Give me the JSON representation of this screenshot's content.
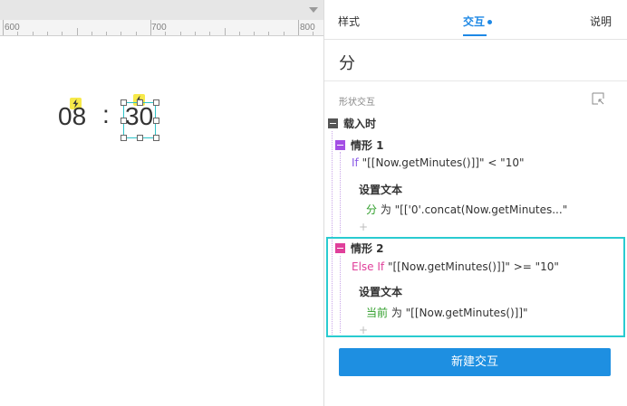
{
  "canvas": {
    "ruler_labels": [
      "600",
      "700",
      "800"
    ],
    "hour": "08",
    "separator": ":",
    "minute": "30"
  },
  "panel": {
    "tabs": [
      {
        "label": "样式",
        "active": false
      },
      {
        "label": "交互",
        "active": true,
        "has_dot": true
      },
      {
        "label": "说明",
        "active": false
      }
    ],
    "shape_name": "分",
    "section_title": "形状交互",
    "event": {
      "label": "载入时"
    },
    "cases": [
      {
        "label": "情形 1",
        "condition_keyword": "If",
        "condition_text": " \"[[Now.getMinutes()]]\" < \"10\"",
        "action_title": "设置文本",
        "target": "分",
        "action_detail": " 为 \"[['0'.concat(Now.getMinutes...\"",
        "add": "+"
      },
      {
        "label": "情形 2",
        "condition_keyword": "Else If",
        "condition_text": " \"[[Now.getMinutes()]]\" >= \"10\"",
        "action_title": "设置文本",
        "target": "当前",
        "action_detail": " 为 \"[[Now.getMinutes()]]\"",
        "add": "+"
      }
    ],
    "new_interaction_label": "新建交互"
  },
  "colors": {
    "accent_blue": "#1e8fe1",
    "selection_cyan": "#29cbd0",
    "case1_marker": "#a44fe5",
    "case2_marker": "#e0409b",
    "target_green": "#2f9e2a",
    "event_marker": "#555555"
  },
  "icons": [
    "lightning-icon",
    "expand-panel-icon",
    "collapse-square-icon"
  ]
}
